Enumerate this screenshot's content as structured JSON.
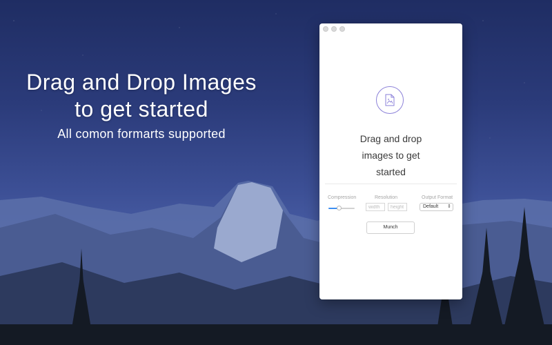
{
  "hero": {
    "title_line1": "Drag and Drop Images",
    "title_line2": "to get started",
    "subtitle": "All comon formarts supported"
  },
  "window": {
    "drop_icon": "image-file-icon",
    "drop_text_line1": "Drag and drop",
    "drop_text_line2": "images to get",
    "drop_text_line3": "started",
    "controls": {
      "compression_label": "Compression",
      "compression_level": 0.4,
      "resolution_label": "Resolution",
      "width_placeholder": "width",
      "height_placeholder": "height",
      "output_format_label": "Output Format",
      "output_format_value": "Default",
      "output_format_chevron": "⌃⌄"
    },
    "munch_label": "Munch"
  },
  "colors": {
    "accent_purple": "#8a7fd8",
    "slider_blue": "#3d8ef2"
  }
}
